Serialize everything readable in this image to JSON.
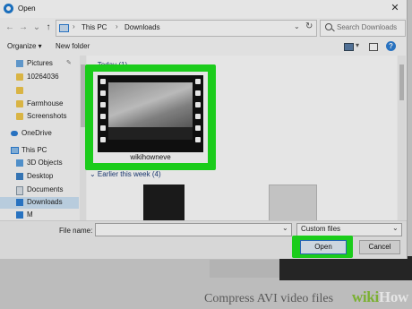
{
  "background": {
    "article_text": "Compress AVI video files",
    "badge_wiki": "wiki",
    "badge_how": "How"
  },
  "dialog": {
    "title": "Open",
    "close_glyph": "✕"
  },
  "address": {
    "back": "←",
    "forward": "→",
    "dropdown": "⌄",
    "up": "↑",
    "separator": "›",
    "crumbs": [
      "This PC",
      "Downloads"
    ],
    "refresh": "↻",
    "search_placeholder": "Search Downloads"
  },
  "toolbar": {
    "organize": "Organize ▾",
    "new_folder": "New folder",
    "view_drop": "▾",
    "help": "?"
  },
  "nav": {
    "items": [
      {
        "label": "Pictures",
        "icon": "pictures-icon"
      },
      {
        "label": "10264036",
        "icon": "folder-icon"
      },
      {
        "label": "",
        "icon": "folder-icon"
      },
      {
        "label": "Farmhouse",
        "icon": "folder-icon"
      },
      {
        "label": "Screenshots",
        "icon": "folder-icon"
      },
      {
        "label": "OneDrive",
        "icon": "cloud-icon"
      },
      {
        "label": "This PC",
        "icon": "computer-icon"
      },
      {
        "label": "3D Objects",
        "icon": "cube-icon"
      },
      {
        "label": "Desktop",
        "icon": "desktop-icon"
      },
      {
        "label": "Documents",
        "icon": "documents-icon"
      },
      {
        "label": "Downloads",
        "icon": "downloads-icon"
      },
      {
        "label": "M",
        "icon": "music-icon"
      }
    ],
    "pin_glyph": "✎"
  },
  "content": {
    "group_today": "⌄ Today (1)",
    "group_earlier": "⌄ Earlier this week (4)",
    "file_name": "wikihowneve"
  },
  "bottom": {
    "file_name_label": "File name:",
    "file_name_value": "",
    "file_type": "Custom files",
    "dropdown": "⌄",
    "open": "Open",
    "cancel": "Cancel"
  },
  "colors": {
    "highlight": "#1fe41f",
    "accent": "#2a72c8"
  }
}
